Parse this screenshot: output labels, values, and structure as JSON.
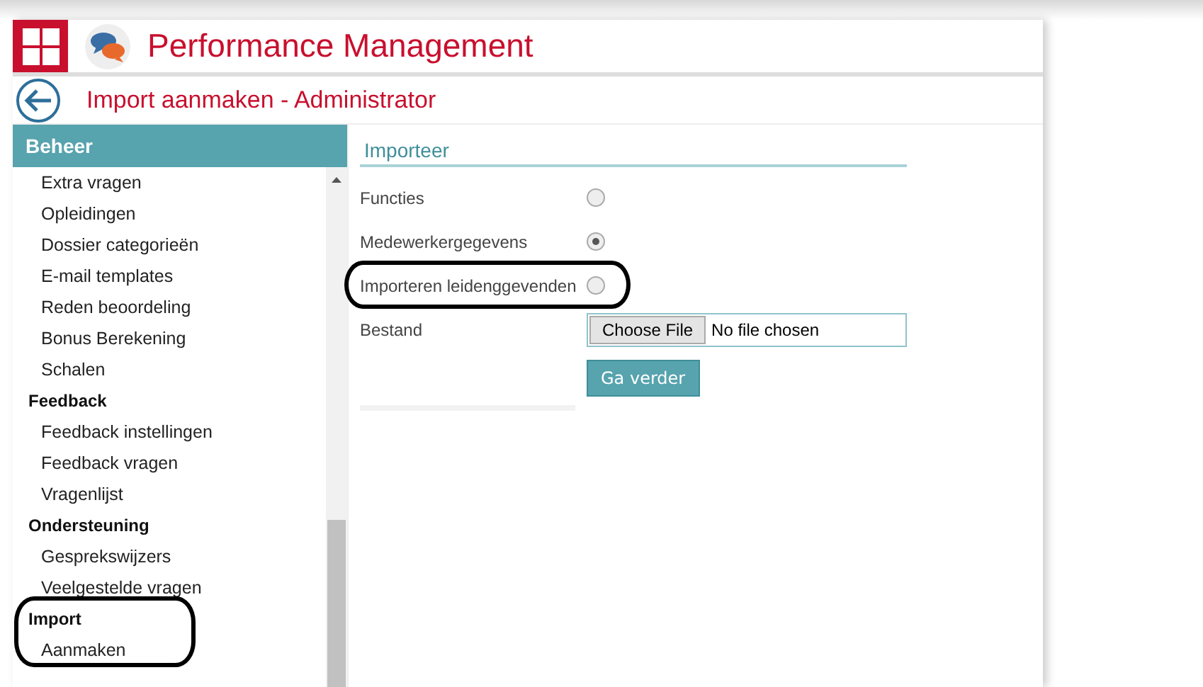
{
  "header": {
    "title": "Performance Management"
  },
  "page": {
    "title": "Import aanmaken - Administrator"
  },
  "sidebar": {
    "title": "Beheer",
    "groups": [
      {
        "items": [
          {
            "label": "Extra vragen"
          },
          {
            "label": "Opleidingen"
          },
          {
            "label": "Dossier categorieën"
          },
          {
            "label": "E-mail templates"
          },
          {
            "label": "Reden beoordeling"
          },
          {
            "label": "Bonus Berekening"
          },
          {
            "label": "Schalen"
          }
        ]
      },
      {
        "label": "Feedback",
        "items": [
          {
            "label": "Feedback instellingen"
          },
          {
            "label": "Feedback vragen"
          },
          {
            "label": "Vragenlijst"
          }
        ]
      },
      {
        "label": "Ondersteuning",
        "items": [
          {
            "label": "Gesprekswijzers"
          },
          {
            "label": "Veelgestelde vragen"
          }
        ]
      },
      {
        "label": "Import",
        "items": [
          {
            "label": "Aanmaken"
          }
        ]
      }
    ]
  },
  "form": {
    "title": "Importeer",
    "options": [
      {
        "label": "Functies",
        "selected": false
      },
      {
        "label": "Medewerkergegevens",
        "selected": true
      },
      {
        "label": "Importeren leidenggevenden",
        "selected": false
      }
    ],
    "file": {
      "label": "Bestand",
      "button": "Choose File",
      "value": "No file chosen"
    },
    "submit": "Ga verder"
  }
}
